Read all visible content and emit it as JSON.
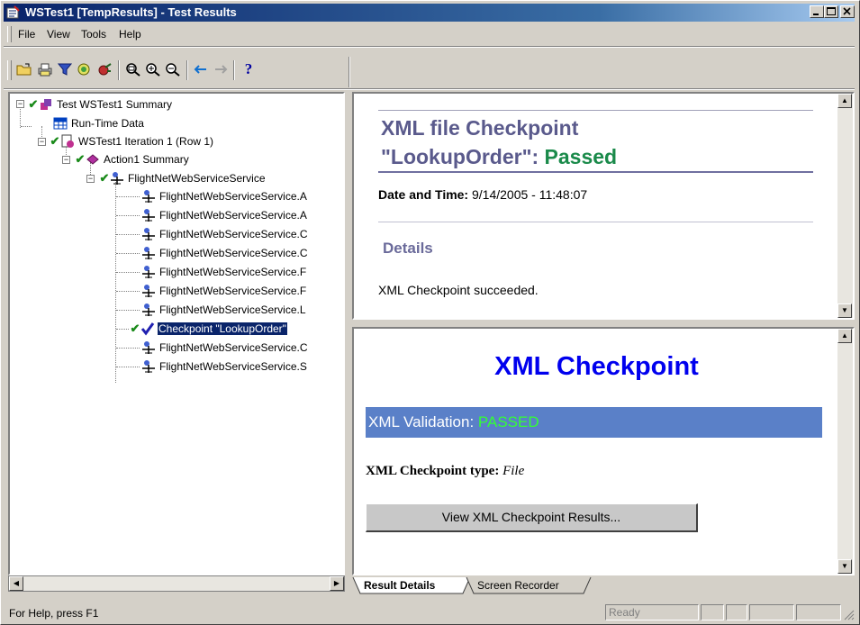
{
  "window": {
    "title": "WSTest1 [TempResults] - Test Results"
  },
  "menu": {
    "file": "File",
    "view": "View",
    "tools": "Tools",
    "help": "Help"
  },
  "tree": {
    "root": "Test WSTest1 Summary",
    "runtime": "Run-Time Data",
    "iteration": "WSTest1 Iteration 1 (Row 1)",
    "action": "Action1 Summary",
    "service": "FlightNetWebServiceService",
    "steps": [
      "FlightNetWebServiceService.A",
      "FlightNetWebServiceService.A",
      "FlightNetWebServiceService.C",
      "FlightNetWebServiceService.C",
      "FlightNetWebServiceService.F",
      "FlightNetWebServiceService.F",
      "FlightNetWebServiceService.L",
      "Checkpoint \"LookupOrder\"",
      "FlightNetWebServiceService.C",
      "FlightNetWebServiceService.S"
    ]
  },
  "top_pane": {
    "heading_line1": "XML file Checkpoint",
    "heading_line2_prefix": "\"LookupOrder\": ",
    "heading_status": "Passed",
    "date_label": "Date and Time:",
    "date_value": " 9/14/2005 - 11:48:07",
    "details_heading": "Details",
    "details_text": "XML Checkpoint succeeded."
  },
  "bottom_pane": {
    "title": "XML Checkpoint",
    "validation_label": "XML Validation: ",
    "validation_status": "PASSED",
    "type_label": "XML Checkpoint type:",
    "type_value": "File",
    "results_button": "View XML Checkpoint Results..."
  },
  "tabs": {
    "result_details": "Result Details",
    "screen_recorder": "Screen Recorder"
  },
  "status": {
    "help": "For Help, press F1",
    "state": "Ready"
  },
  "colors": {
    "title_bar": "#0a246a",
    "passed_green": "#1a8a4a",
    "validation_bar": "#5a80c8",
    "validation_passed": "#33ff33",
    "checkpoint_title": "#0000ee"
  }
}
